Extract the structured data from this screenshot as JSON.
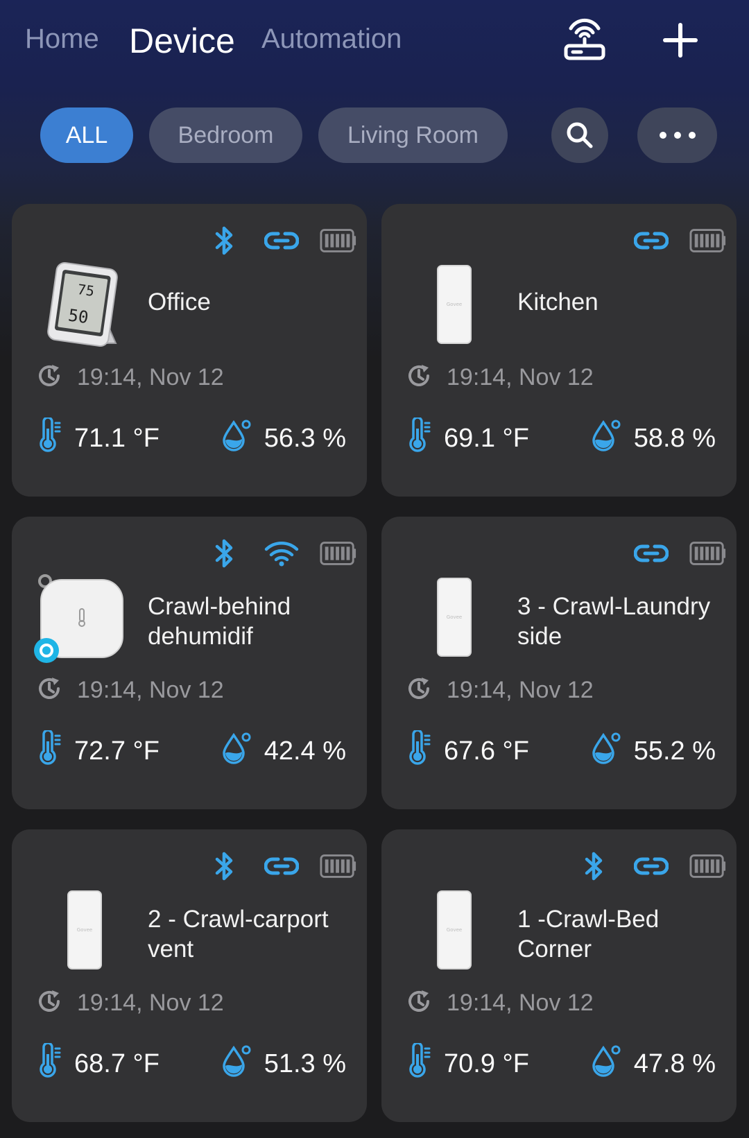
{
  "nav": {
    "tabs": [
      "Home",
      "Device",
      "Automation"
    ],
    "active_tab": "Device"
  },
  "filters": {
    "chips": [
      "ALL",
      "Bedroom",
      "Living Room"
    ],
    "active": "ALL"
  },
  "icons": {
    "gateway": "gateway-router-icon",
    "add": "plus-icon",
    "search": "search-icon",
    "more": "more-dots-icon",
    "clock": "refresh-clock-icon",
    "thermometer": "thermometer-icon",
    "humidity": "humidity-drop-icon"
  },
  "colors": {
    "accent": "#3aa6ea",
    "active_chip": "#3c7fd2",
    "card_bg": "#323234"
  },
  "devices": [
    {
      "name": "Office",
      "status": [
        "bluetooth",
        "link",
        "battery"
      ],
      "thumb": "lcd-hygrometer",
      "time": "19:14, Nov 12",
      "temp": "71.1 °F",
      "humidity": "56.3 %"
    },
    {
      "name": "Kitchen",
      "status": [
        "link",
        "battery"
      ],
      "thumb": "stick-sensor",
      "time": "19:14, Nov 12",
      "temp": "69.1 °F",
      "humidity": "58.8 %"
    },
    {
      "name": "Crawl-behind dehumidif",
      "status": [
        "bluetooth",
        "wifi",
        "battery"
      ],
      "thumb": "square-sensor",
      "time": "19:14, Nov 12",
      "temp": "72.7 °F",
      "humidity": "42.4 %"
    },
    {
      "name": "3 - Crawl-Laundry side",
      "status": [
        "link",
        "battery"
      ],
      "thumb": "stick-sensor",
      "time": "19:14, Nov 12",
      "temp": "67.6 °F",
      "humidity": "55.2 %"
    },
    {
      "name": "2 - Crawl-carport vent",
      "status": [
        "bluetooth",
        "link",
        "battery"
      ],
      "thumb": "stick-sensor",
      "time": "19:14, Nov 12",
      "temp": "68.7 °F",
      "humidity": "51.3 %"
    },
    {
      "name": "1 -Crawl-Bed Corner",
      "status": [
        "bluetooth",
        "link",
        "battery"
      ],
      "thumb": "stick-sensor",
      "time": "19:14, Nov 12",
      "temp": "70.9 °F",
      "humidity": "47.8 %"
    }
  ]
}
